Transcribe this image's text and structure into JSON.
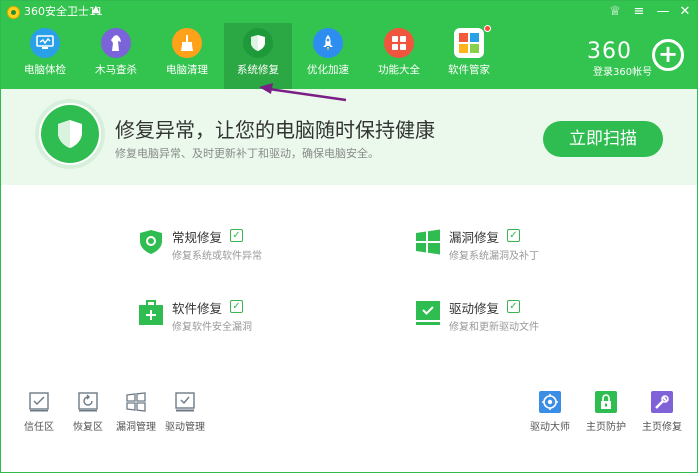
{
  "app": {
    "title": "360安全卫士11"
  },
  "window_controls": {
    "skin": "♕",
    "menu": "≡",
    "minimize": "—",
    "close": "✕"
  },
  "nav": [
    {
      "label": "电脑体检",
      "icon": "monitor-check-icon",
      "color": "#2aa0e8"
    },
    {
      "label": "木马查杀",
      "icon": "horse-icon",
      "color": "#7b63d9"
    },
    {
      "label": "电脑清理",
      "icon": "broom-icon",
      "color": "#ffa21a"
    },
    {
      "label": "系统修复",
      "icon": "shield-icon",
      "color": "#1f9a3a",
      "active": true
    },
    {
      "label": "优化加速",
      "icon": "rocket-icon",
      "color": "#2e8ef0"
    },
    {
      "label": "功能大全",
      "icon": "grid-icon",
      "color": "#f2553e"
    },
    {
      "label": "软件管家",
      "icon": "software-store-icon",
      "color": "#ffffff",
      "badge": true
    }
  ],
  "brand": {
    "logo_text": "360",
    "account_label": "登录360帐号"
  },
  "hero": {
    "title": "修复异常，让您的电脑随时保持健康",
    "subtitle": "修复电脑异常、及时更新补丁和驱动，确保电脑安全。",
    "scan_label": "立即扫描"
  },
  "repairs": [
    {
      "title": "常规修复",
      "desc": "修复系统或软件异常",
      "checked": true,
      "icon": "shield-repair-icon"
    },
    {
      "title": "漏洞修复",
      "desc": "修复系统漏洞及补丁",
      "checked": true,
      "icon": "windows-icon"
    },
    {
      "title": "软件修复",
      "desc": "修复软件安全漏洞",
      "checked": true,
      "icon": "medical-kit-icon"
    },
    {
      "title": "驱动修复",
      "desc": "修复和更新驱动文件",
      "checked": true,
      "icon": "driver-icon"
    }
  ],
  "tools_left": [
    {
      "label": "信任区",
      "icon": "trust-zone-icon"
    },
    {
      "label": "恢复区",
      "icon": "restore-zone-icon"
    },
    {
      "label": "漏洞管理",
      "icon": "vulnerability-manage-icon"
    },
    {
      "label": "驱动管理",
      "icon": "driver-manage-icon"
    }
  ],
  "tools_right": [
    {
      "label": "驱动大师",
      "icon": "driver-master-icon",
      "color": "#3a8ee6"
    },
    {
      "label": "主页防护",
      "icon": "homepage-guard-icon",
      "color": "#2fbd51"
    },
    {
      "label": "主页修复",
      "icon": "homepage-repair-icon",
      "color": "#7f61d8"
    }
  ],
  "colors": {
    "accent": "#33c44f",
    "hero_bg": "#eaf9ec",
    "annotation": "#7a1f86"
  }
}
